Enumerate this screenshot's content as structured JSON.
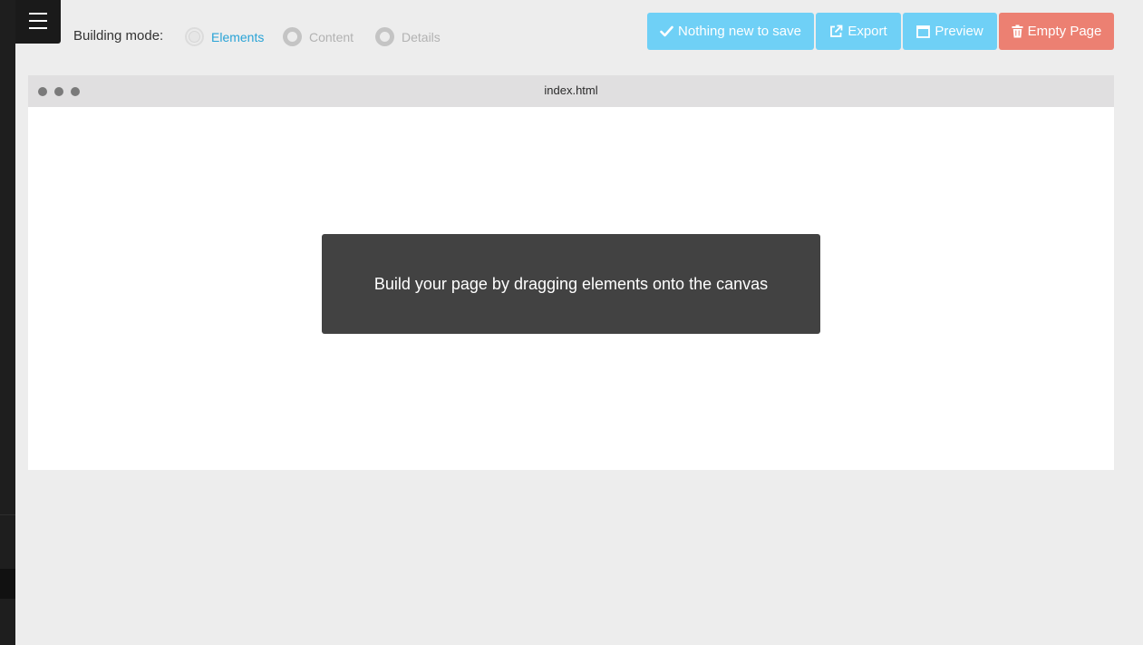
{
  "sidebar": {
    "menu_icon": "hamburger-icon"
  },
  "building_mode": {
    "label": "Building mode:",
    "options": [
      {
        "label": "Elements",
        "selected": true
      },
      {
        "label": "Content",
        "selected": false
      },
      {
        "label": "Details",
        "selected": false
      }
    ]
  },
  "toolbar": {
    "save": {
      "label": "Nothing new to save",
      "icon": "check-icon"
    },
    "export": {
      "label": "Export",
      "icon": "external-link-icon"
    },
    "preview": {
      "label": "Preview",
      "icon": "window-icon"
    },
    "empty_page": {
      "label": "Empty Page",
      "icon": "trash-icon"
    }
  },
  "canvas": {
    "filename": "index.html",
    "hint": "Build your page by dragging elements onto the canvas"
  },
  "colors": {
    "accent_blue": "#6fd0f6",
    "danger_red": "#ec8072",
    "active_mode": "#29a3d6",
    "sidebar_bg": "#1e1e1e",
    "hint_bg": "#424242"
  }
}
